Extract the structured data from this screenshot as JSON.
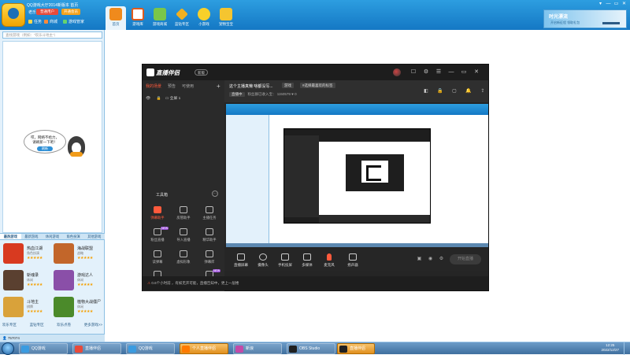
{
  "qq_hall": {
    "window_title": "QQ游戏大厅2014新版本 首页",
    "user_name": "老乐",
    "user_badge": "普通用户",
    "vip_label": "开通会员",
    "mini_links": [
      "任务",
      "商城",
      "游戏管家"
    ],
    "nav_items": [
      "首页",
      "游戏库",
      "游戏商城",
      "蓝钻专区",
      "小游戏",
      "宠物宝宝"
    ],
    "window_controls": [
      "▾",
      "—",
      "▭",
      "✕"
    ],
    "banner_title": "时光漂流",
    "banner_subtitle": "开启新征程  领取礼包",
    "search_placeholder": "查找游戏（例如：“欢乐斗地主”）",
    "offline_message": "哎，网络不给力，请刷新一下吧！",
    "refresh_label": "刷新",
    "game_tabs": [
      "最热游戏",
      "最新游戏",
      "休闲游戏",
      "角色扮演",
      "其他游戏"
    ],
    "games": [
      {
        "name": "热血江湖",
        "tag": "角色扮演",
        "stars": "★★★★★",
        "color": "#d83a20"
      },
      {
        "name": "海战联盟",
        "tag": "战略",
        "stars": "★★★★★",
        "color": "#c2662a"
      },
      {
        "name": "斩魂录",
        "tag": "休闲",
        "stars": "★★★★★",
        "color": "#5a4030"
      },
      {
        "name": "游戏达人",
        "tag": "休闲",
        "stars": "★★★★★",
        "color": "#8a4fa8"
      },
      {
        "name": "斗地主",
        "tag": "棋牌",
        "stars": "★★★★★",
        "color": "#d9a23a"
      },
      {
        "name": "植物大战僵尸",
        "tag": "休闲",
        "stars": "★★★★★",
        "color": "#4b8a2a"
      }
    ],
    "bottom_links": [
      "欢乐专区",
      "蓝钻专区",
      "欢乐点卷",
      "更多游戏>>"
    ],
    "online_count": "757074"
  },
  "live_partner": {
    "app_name": "直播伴侣",
    "version_tag": "新版",
    "title_icons": [
      "☐",
      "⚙",
      "☰",
      "—",
      "▭",
      "✕"
    ],
    "side_tabs": [
      "我的场景",
      "预告",
      "可使用"
    ],
    "add_icon": "+",
    "scene_name": "全屏 1",
    "tools_label": "工具箱",
    "tools": [
      {
        "label": "弹幕助手",
        "highlight": true,
        "badge": ""
      },
      {
        "label": "房管助手",
        "highlight": false,
        "badge": ""
      },
      {
        "label": "主播任务",
        "highlight": false,
        "badge": ""
      },
      {
        "label": "粉丝直播",
        "highlight": false,
        "badge": "NEW"
      },
      {
        "label": "导入直播",
        "highlight": false,
        "badge": ""
      },
      {
        "label": "精华助手",
        "highlight": false,
        "badge": ""
      },
      {
        "label": "读弹幕",
        "highlight": false,
        "badge": ""
      },
      {
        "label": "虚拟形象",
        "highlight": false,
        "badge": ""
      },
      {
        "label": "弹幕库",
        "highlight": false,
        "badge": ""
      },
      {
        "label": "录屏",
        "highlight": false,
        "badge": ""
      },
      {
        "label": "",
        "highlight": false,
        "badge": "NEW"
      }
    ],
    "room_title": "这个主播真懒 啥都没写...",
    "room_category": "游戏",
    "room_tag": "#选择最喜欢的标签",
    "room_detail_pill": "直播中",
    "room_detail": "粉丝群已收入宝： 1150579   ♥ 0",
    "room_icons": [
      "◧",
      "🔒",
      "▢",
      "🔔",
      "⇪"
    ],
    "controls": [
      "直播屏幕",
      "摄像头",
      "手机投屏",
      "多媒体",
      "麦克风",
      "扬声器"
    ],
    "start_label": "开始直播",
    "status_text": "0.6个小时前 ，有如无开可能，直播告知中，更上一层楼"
  },
  "taskbar": {
    "items": [
      {
        "label": "QQ游戏",
        "color": "#3a9be0",
        "active": false
      },
      {
        "label": "直播伴侣",
        "color": "#e84a3a",
        "active": false
      },
      {
        "label": "QQ游戏",
        "color": "#3a9be0",
        "active": false
      },
      {
        "label": "个人直播伴侣",
        "color": "#ff7a00",
        "active": true
      },
      {
        "label": "新浪",
        "color": "#c44aa8",
        "active": false
      },
      {
        "label": "OBS Studio",
        "color": "#202020",
        "active": false
      },
      {
        "label": "直播伴侣",
        "color": "#202020",
        "active": true
      }
    ],
    "tray_time": "12:25",
    "tray_date": "2022/12/27"
  }
}
